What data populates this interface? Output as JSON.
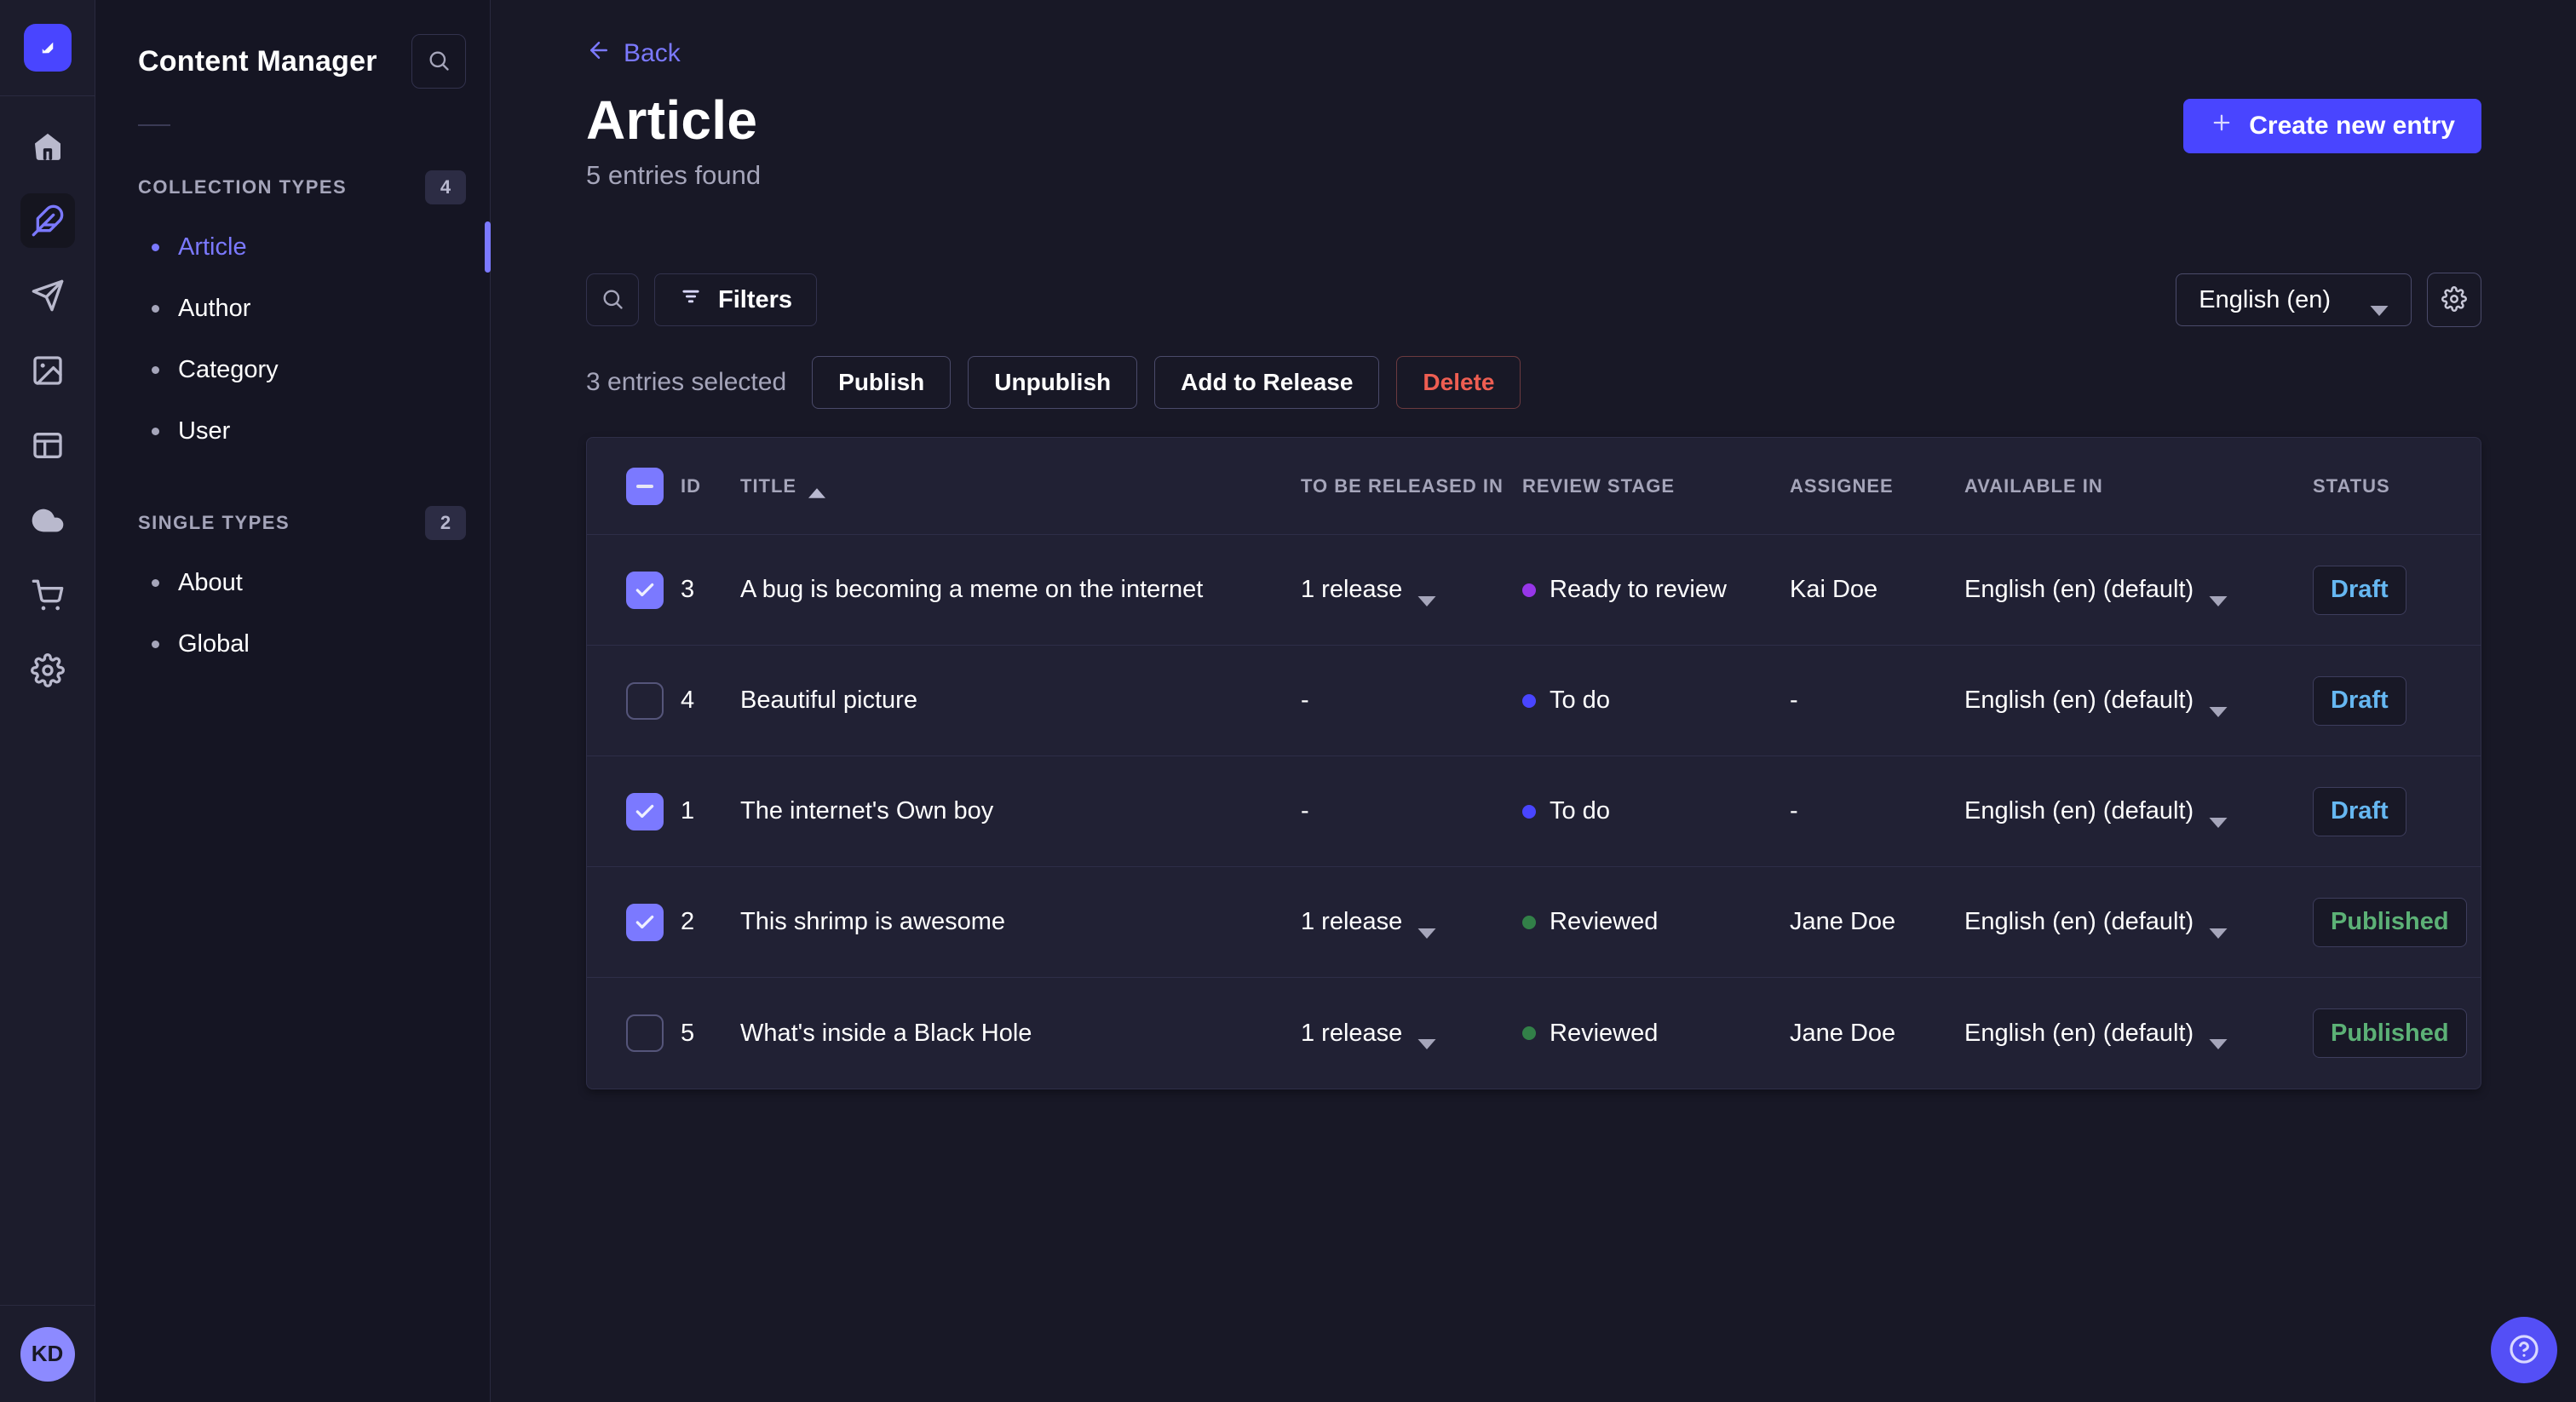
{
  "colors": {
    "accent": "#4945ff",
    "accent_light": "#7b79ff",
    "draft": "#66b7f1",
    "published": "#5cb176",
    "danger": "#ee5e52"
  },
  "rail": {
    "items": [
      {
        "name": "home"
      },
      {
        "name": "content",
        "active": true
      },
      {
        "name": "releases"
      },
      {
        "name": "media-library"
      },
      {
        "name": "content-type-builder"
      },
      {
        "name": "deploy"
      },
      {
        "name": "marketplace"
      },
      {
        "name": "settings"
      }
    ],
    "avatar_initials": "KD"
  },
  "subnav": {
    "title": "Content Manager",
    "sections": [
      {
        "label": "Collection Types",
        "badge": "4",
        "items": [
          {
            "label": "Article",
            "active": true
          },
          {
            "label": "Author"
          },
          {
            "label": "Category"
          },
          {
            "label": "User"
          }
        ]
      },
      {
        "label": "Single Types",
        "badge": "2",
        "items": [
          {
            "label": "About"
          },
          {
            "label": "Global"
          }
        ]
      }
    ]
  },
  "header": {
    "back_label": "Back",
    "title": "Article",
    "subtitle": "5 entries found",
    "create_label": "Create new entry"
  },
  "toolbar": {
    "filters_label": "Filters",
    "locale_value": "English (en)"
  },
  "selection": {
    "label": "3 entries selected",
    "publish": "Publish",
    "unpublish": "Unpublish",
    "add_to_release": "Add to Release",
    "delete": "Delete"
  },
  "table": {
    "columns": [
      "ID",
      "Title",
      "To be released in",
      "Review stage",
      "Assignee",
      "Available in",
      "Status"
    ],
    "sort": {
      "column": "Title",
      "direction": "asc"
    },
    "rows": [
      {
        "checked": true,
        "id": "3",
        "title": "A bug is becoming a meme on the internet",
        "release": "1 release",
        "stage": "Ready to review",
        "stage_color": "#9736e8",
        "assignee": "Kai Doe",
        "locale": "English (en) (default)",
        "status": "Draft",
        "status_color": "#66b7f1"
      },
      {
        "checked": false,
        "id": "4",
        "title": "Beautiful picture",
        "release": "-",
        "stage": "To do",
        "stage_color": "#4945ff",
        "assignee": "-",
        "locale": "English (en) (default)",
        "status": "Draft",
        "status_color": "#66b7f1"
      },
      {
        "checked": true,
        "id": "1",
        "title": "The internet's Own boy",
        "release": "-",
        "stage": "To do",
        "stage_color": "#4945ff",
        "assignee": "-",
        "locale": "English (en) (default)",
        "status": "Draft",
        "status_color": "#66b7f1"
      },
      {
        "checked": true,
        "id": "2",
        "title": "This shrimp is awesome",
        "release": "1 release",
        "stage": "Reviewed",
        "stage_color": "#328048",
        "assignee": "Jane Doe",
        "locale": "English (en) (default)",
        "status": "Published",
        "status_color": "#5cb176"
      },
      {
        "checked": false,
        "id": "5",
        "title": "What's inside a Black Hole",
        "release": "1 release",
        "stage": "Reviewed",
        "stage_color": "#328048",
        "assignee": "Jane Doe",
        "locale": "English (en) (default)",
        "status": "Published",
        "status_color": "#5cb176"
      }
    ]
  }
}
